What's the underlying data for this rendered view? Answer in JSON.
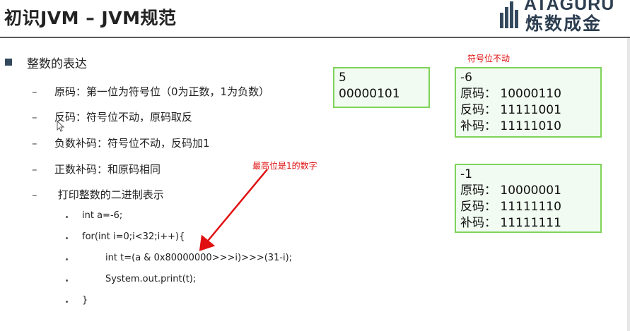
{
  "header": {
    "title": "初识JVM – JVM规范",
    "logo_latin": "ATAGURU",
    "logo_cn": "炼数成金"
  },
  "content": {
    "bullet_heading": "整数的表达",
    "items": [
      {
        "dash": "–",
        "text": "原码：第一位为符号位（0为正数，1为负数）"
      },
      {
        "dash": "–",
        "text": "反码：符号位不动，原码取反"
      },
      {
        "dash": "–",
        "text": "负数补码：符号位不动，反码加1"
      },
      {
        "dash": "–",
        "text": "正数补码：和原码相同"
      },
      {
        "dash": "–",
        "text": " 打印整数的二进制表示"
      }
    ],
    "code_lines": [
      "int a=-6;",
      "for(int i=0;i<32;i++){",
      "        int t=(a & 0x80000000>>>i)>>>(31-i);",
      "        System.out.print(t);",
      "}"
    ]
  },
  "boxes": {
    "five": {
      "line1": "5",
      "line2": "00000101"
    },
    "neg6": {
      "line1": "-6",
      "line2": "原码： 10000110",
      "line3": "反码： 11111001",
      "line4": "补码： 11111010"
    },
    "neg1": {
      "line1": "-1",
      "line2": "原码： 10000001",
      "line3": "反码： 11111110",
      "line4": "补码： 11111111"
    }
  },
  "annotations": {
    "sign_bit_note": "符号位不动",
    "highest_bit_note": "最高位是1的数字"
  },
  "colors": {
    "box_border": "#7fd35a",
    "annotation_red": "#e01010",
    "title_rule": "#5a5a5a"
  }
}
